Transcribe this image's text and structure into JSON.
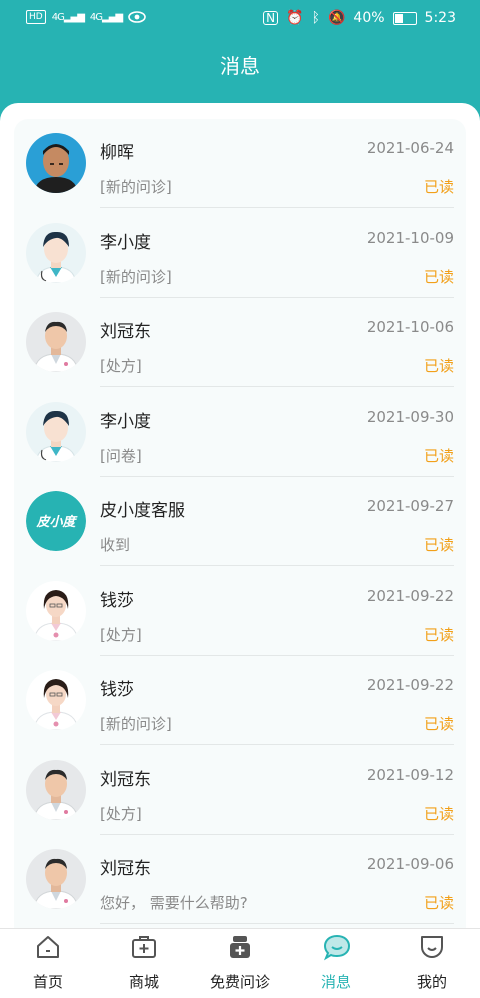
{
  "status_bar": {
    "hd": "HD",
    "net1": "4G",
    "net2": "4G",
    "battery": "40%",
    "time": "5:23"
  },
  "header": {
    "title": "消息"
  },
  "messages": [
    {
      "name": "柳晖",
      "date": "2021-06-24",
      "preview": "[新的问诊]",
      "status": "已读",
      "avatar": "photo-man"
    },
    {
      "name": "李小度",
      "date": "2021-10-09",
      "preview": "[新的问诊]",
      "status": "已读",
      "avatar": "doctor-cartoon"
    },
    {
      "name": "刘冠东",
      "date": "2021-10-06",
      "preview": "[处方]",
      "status": "已读",
      "avatar": "doctor-male-photo"
    },
    {
      "name": "李小度",
      "date": "2021-09-30",
      "preview": "[问卷]",
      "status": "已读",
      "avatar": "doctor-cartoon"
    },
    {
      "name": "皮小度客服",
      "date": "2021-09-27",
      "preview": "收到",
      "status": "已读",
      "avatar": "service-logo",
      "avatar_text": "皮小度"
    },
    {
      "name": "钱莎",
      "date": "2021-09-22",
      "preview": "[处方]",
      "status": "已读",
      "avatar": "doctor-female-photo"
    },
    {
      "name": "钱莎",
      "date": "2021-09-22",
      "preview": "[新的问诊]",
      "status": "已读",
      "avatar": "doctor-female-photo"
    },
    {
      "name": "刘冠东",
      "date": "2021-09-12",
      "preview": "[处方]",
      "status": "已读",
      "avatar": "doctor-male-photo"
    },
    {
      "name": "刘冠东",
      "date": "2021-09-06",
      "preview": "您好， 需要什么帮助?",
      "status": "已读",
      "avatar": "doctor-male-photo"
    }
  ],
  "tabs": [
    {
      "label": "首页",
      "icon": "home-icon",
      "active": false
    },
    {
      "label": "商城",
      "icon": "medkit-icon",
      "active": false
    },
    {
      "label": "免费问诊",
      "icon": "doctor-icon",
      "active": false
    },
    {
      "label": "消息",
      "icon": "chat-icon",
      "active": true
    },
    {
      "label": "我的",
      "icon": "smile-icon",
      "active": false
    }
  ],
  "colors": {
    "brand": "#27b3b3",
    "read": "#f2a01a",
    "muted": "#8a8a8a"
  }
}
